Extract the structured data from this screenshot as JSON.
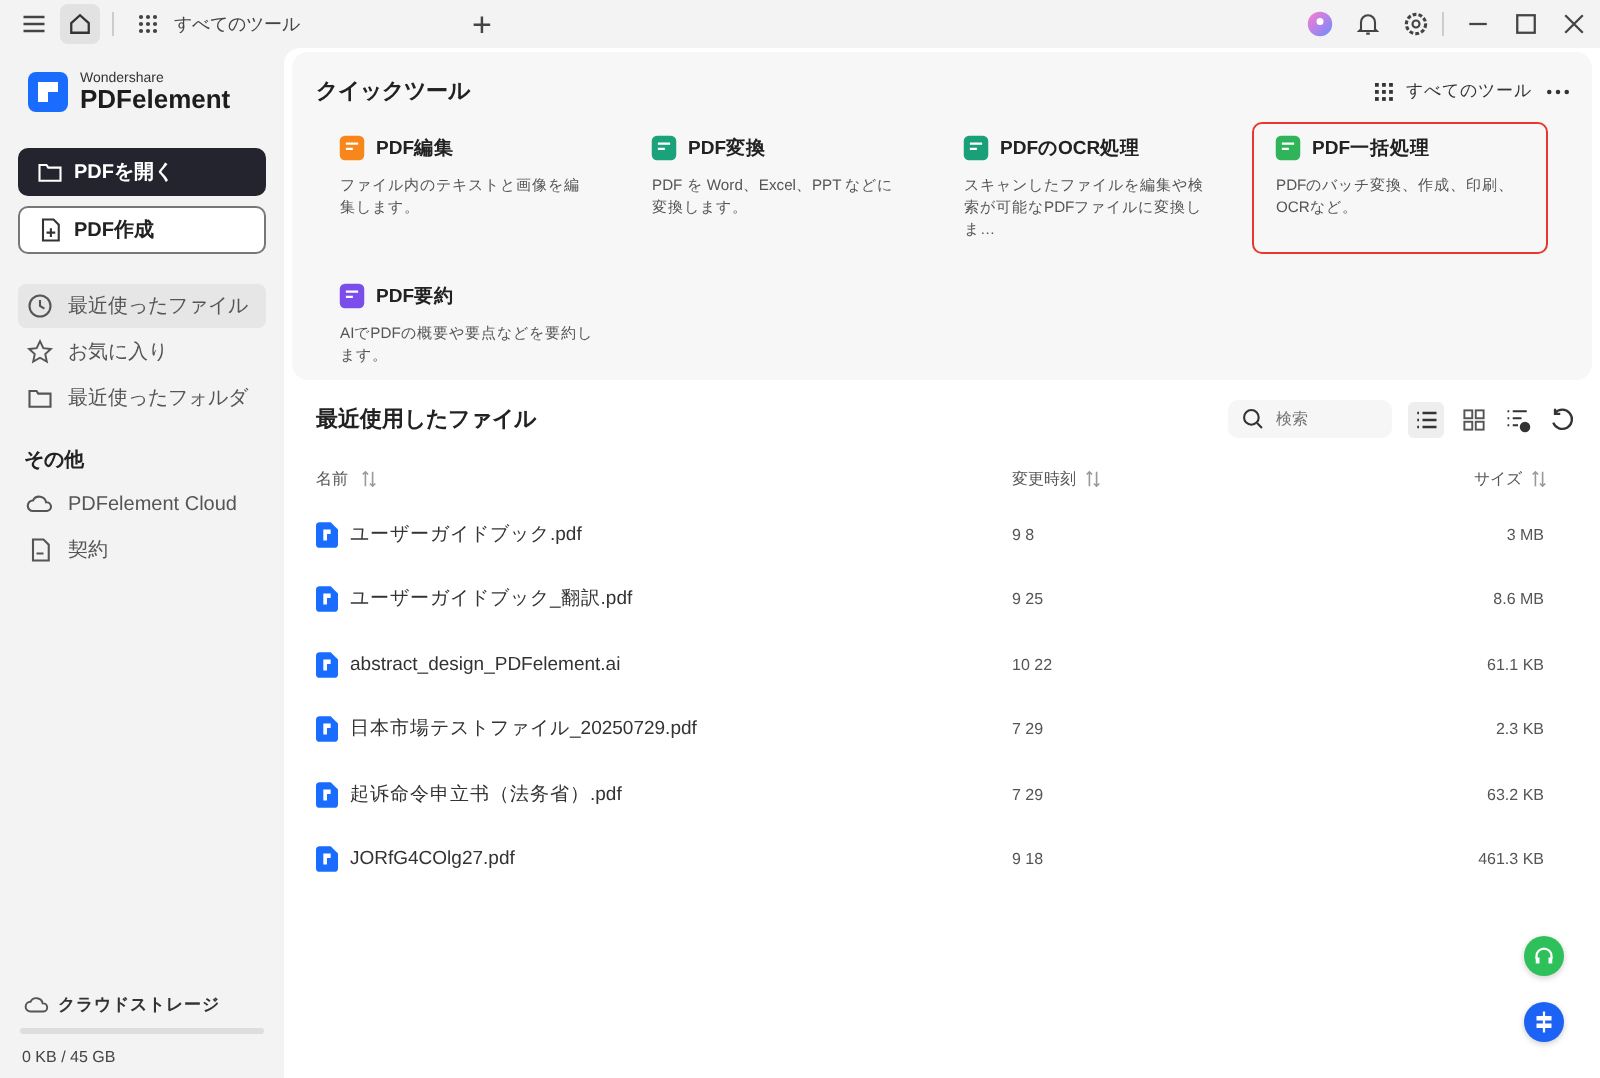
{
  "titlebar": {
    "tab_label": "すべてのツール",
    "new_tab": "+"
  },
  "sidebar": {
    "brand_small": "Wondershare",
    "brand": "PDFelement",
    "primary_buttons": [
      {
        "label": "PDFを開く",
        "kind": "dark"
      },
      {
        "label": "PDF作成",
        "kind": "outline"
      }
    ],
    "items": [
      {
        "label": "最近使ったファイル",
        "selected": true
      },
      {
        "label": "お気に入り",
        "selected": false
      },
      {
        "label": "最近使ったフォルダ",
        "selected": false
      }
    ],
    "section_title": "その他",
    "other_items": [
      {
        "label": "PDFelement Cloud"
      },
      {
        "label": "契約"
      }
    ],
    "storage": {
      "label": "クラウドストレージ",
      "usage": "0 KB / 45 GB"
    }
  },
  "quick_tools": {
    "title": "クイックツール",
    "all_tools": "すべてのツール",
    "tools": [
      {
        "name": "PDF編集",
        "description": "ファイル内のテキストと画像を編集します。",
        "color": "#f7861b",
        "selected": false
      },
      {
        "name": "PDF変換",
        "description": "PDF を Word、Excel、PPT などに変換します。",
        "color": "#1aa37a",
        "selected": false
      },
      {
        "name": "PDFのOCR処理",
        "description": "スキャンしたファイルを編集や検索が可能なPDFファイルに変換しま…",
        "color": "#19a078",
        "selected": false
      },
      {
        "name": "PDF一括処理",
        "description": "PDFのバッチ変換、作成、印刷、OCRなど。",
        "color": "#2fb45a",
        "selected": true
      },
      {
        "name": "PDF要約",
        "description": "AIでPDFの概要や要点などを要約します。",
        "color": "#7b4dea",
        "selected": false
      }
    ]
  },
  "recent": {
    "title": "最近使用したファイル",
    "search_placeholder": "検索",
    "columns": [
      "名前",
      "変更時刻",
      "サイズ"
    ],
    "rows": [
      {
        "name": "ユーザーガイドブック.pdf",
        "modified": "9 8",
        "size": "3 MB"
      },
      {
        "name": "ユーザーガイドブック_翻訳.pdf",
        "modified": "9 25",
        "size": "8.6 MB"
      },
      {
        "name": "abstract_design_PDFelement.ai",
        "modified": "10 22",
        "size": "61.1 KB"
      },
      {
        "name": "日本市場テストファイル_20250729.pdf",
        "modified": "7 29",
        "size": "2.3 KB"
      },
      {
        "name": "起诉命令申立书（法务省）.pdf",
        "modified": "7 29",
        "size": "63.2 KB"
      },
      {
        "name": "JORfG4COlg27.pdf",
        "modified": "9 18",
        "size": "461.3 KB"
      }
    ]
  }
}
